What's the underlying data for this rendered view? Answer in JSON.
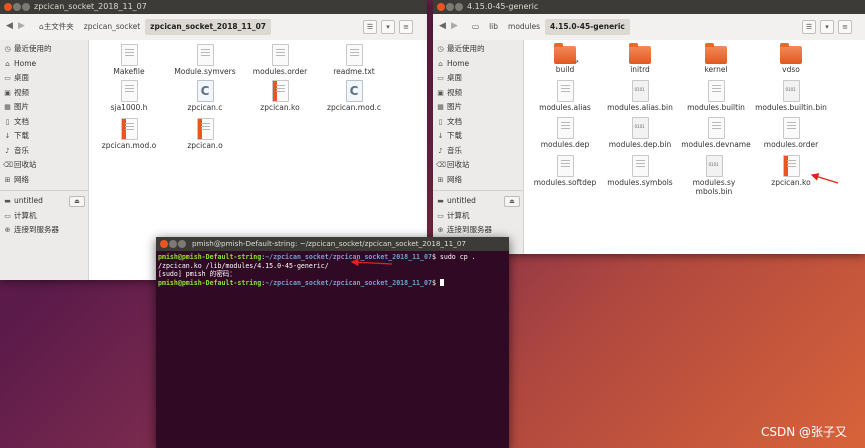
{
  "left_window": {
    "title": "zpcican_socket_2018_11_07",
    "breadcrumbs": [
      "主文件夹",
      "zpcican_socket",
      "zpcican_socket_2018_11_07"
    ],
    "files": [
      {
        "name": "Makefile",
        "icon": "text-file"
      },
      {
        "name": "Module.symvers",
        "icon": "text-file"
      },
      {
        "name": "modules.order",
        "icon": "text-file"
      },
      {
        "name": "readme.txt",
        "icon": "text-file"
      },
      {
        "name": "sja1000.h",
        "icon": "text-file"
      },
      {
        "name": "zpcican.c",
        "icon": "c-source-file"
      },
      {
        "name": "zpcican.ko",
        "icon": "object-file"
      },
      {
        "name": "zpcican.mod.c",
        "icon": "c-source-file"
      },
      {
        "name": "zpcican.mod.o",
        "icon": "object-file"
      },
      {
        "name": "zpcican.o",
        "icon": "object-file"
      }
    ]
  },
  "right_window": {
    "title": "4.15.0-45-generic",
    "breadcrumbs": [
      "lib",
      "modules",
      "4.15.0-45-generic"
    ],
    "files": [
      {
        "name": "build",
        "icon": "folder-link"
      },
      {
        "name": "initrd",
        "icon": "folder"
      },
      {
        "name": "kernel",
        "icon": "folder"
      },
      {
        "name": "vdso",
        "icon": "folder"
      },
      {
        "name": "modules.alias",
        "icon": "text-file"
      },
      {
        "name": "modules.alias.bin",
        "icon": "binary-file"
      },
      {
        "name": "modules.builtin",
        "icon": "text-file"
      },
      {
        "name": "modules.builtin.bin",
        "icon": "binary-file"
      },
      {
        "name": "modules.dep",
        "icon": "text-file"
      },
      {
        "name": "modules.dep.bin",
        "icon": "binary-file"
      },
      {
        "name": "modules.devname",
        "icon": "text-file"
      },
      {
        "name": "modules.order",
        "icon": "text-file"
      },
      {
        "name": "modules.softdep",
        "icon": "text-file"
      },
      {
        "name": "modules.symbols",
        "icon": "text-file"
      },
      {
        "name": "modules.symbols.bin",
        "icon": "binary-file"
      },
      {
        "name": "zpcican.ko",
        "icon": "object-file"
      }
    ]
  },
  "sidebar": {
    "items": [
      {
        "label": "最近使用的",
        "icon": "clock-icon"
      },
      {
        "label": "Home",
        "icon": "home-icon"
      },
      {
        "label": "桌面",
        "icon": "desktop-icon"
      },
      {
        "label": "视频",
        "icon": "video-icon"
      },
      {
        "label": "图片",
        "icon": "picture-icon"
      },
      {
        "label": "文档",
        "icon": "document-icon"
      },
      {
        "label": "下载",
        "icon": "download-icon"
      },
      {
        "label": "音乐",
        "icon": "music-icon"
      },
      {
        "label": "回收站",
        "icon": "trash-icon"
      },
      {
        "label": "网络",
        "icon": "network-icon"
      }
    ],
    "devices": [
      {
        "label": "untitled",
        "icon": "drive-icon"
      },
      {
        "label": "计算机",
        "icon": "computer-icon"
      },
      {
        "label": "连接到服务器",
        "icon": "server-icon"
      }
    ]
  },
  "terminal": {
    "title": "pmish@pmish-Default-string: ~/zpcican_socket/zpcican_socket_2018_11_07",
    "prompt_user": "pmish@pmish-Default-string",
    "prompt_path": "~/zpcican_socket/zpcican_socket_2018_11_07",
    "command_part1": " sudo cp .",
    "command_part2": "/zpcican.ko /lib/modules/4.15.0-45-generic/",
    "sudo_prompt": "[sudo] pmish 的密码：",
    "prompt_symbol": ":",
    "dollar": "$"
  },
  "watermark": "CSDN @张子又",
  "colors": {
    "accent": "#e95420",
    "terminal_bg": "#300a24",
    "prompt_green": "#8ae234",
    "path_blue": "#729fcf"
  }
}
